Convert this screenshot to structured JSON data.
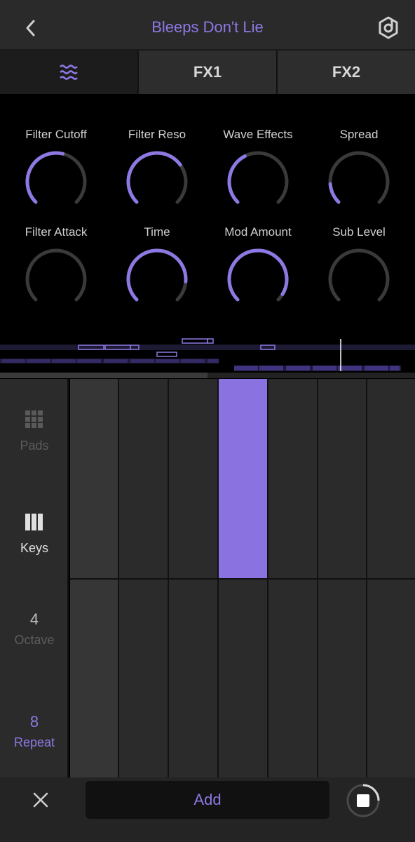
{
  "header": {
    "title": "Bleeps Don't Lie",
    "back_icon": "chevron-left-icon",
    "logo_icon": "app-logo-icon"
  },
  "tabs": [
    {
      "label": "",
      "icon": "wave-icon",
      "active": true
    },
    {
      "label": "FX1",
      "active": false
    },
    {
      "label": "FX2",
      "active": false
    }
  ],
  "knobs": [
    {
      "label": "Filter Cutoff",
      "value": 0.55
    },
    {
      "label": "Filter Reso",
      "value": 0.7
    },
    {
      "label": "Wave Effects",
      "value": 0.4
    },
    {
      "label": "Spread",
      "value": 0.15
    },
    {
      "label": "Filter Attack",
      "value": 0.0
    },
    {
      "label": "Time",
      "value": 0.85
    },
    {
      "label": "Mod Amount",
      "value": 0.95
    },
    {
      "label": "Sub Level",
      "value": 0.0
    }
  ],
  "side": {
    "pads_label": "Pads",
    "keys_label": "Keys",
    "octave_value": "4",
    "octave_label": "Octave",
    "repeat_value": "8",
    "repeat_label": "Repeat"
  },
  "footer": {
    "add_label": "Add",
    "close_icon": "close-icon",
    "stop_icon": "stop-icon"
  },
  "colors": {
    "accent": "#8e78e3",
    "track": "#3a3a3a",
    "cell": "#2b2b2b",
    "active_key": "#8a72e0"
  }
}
